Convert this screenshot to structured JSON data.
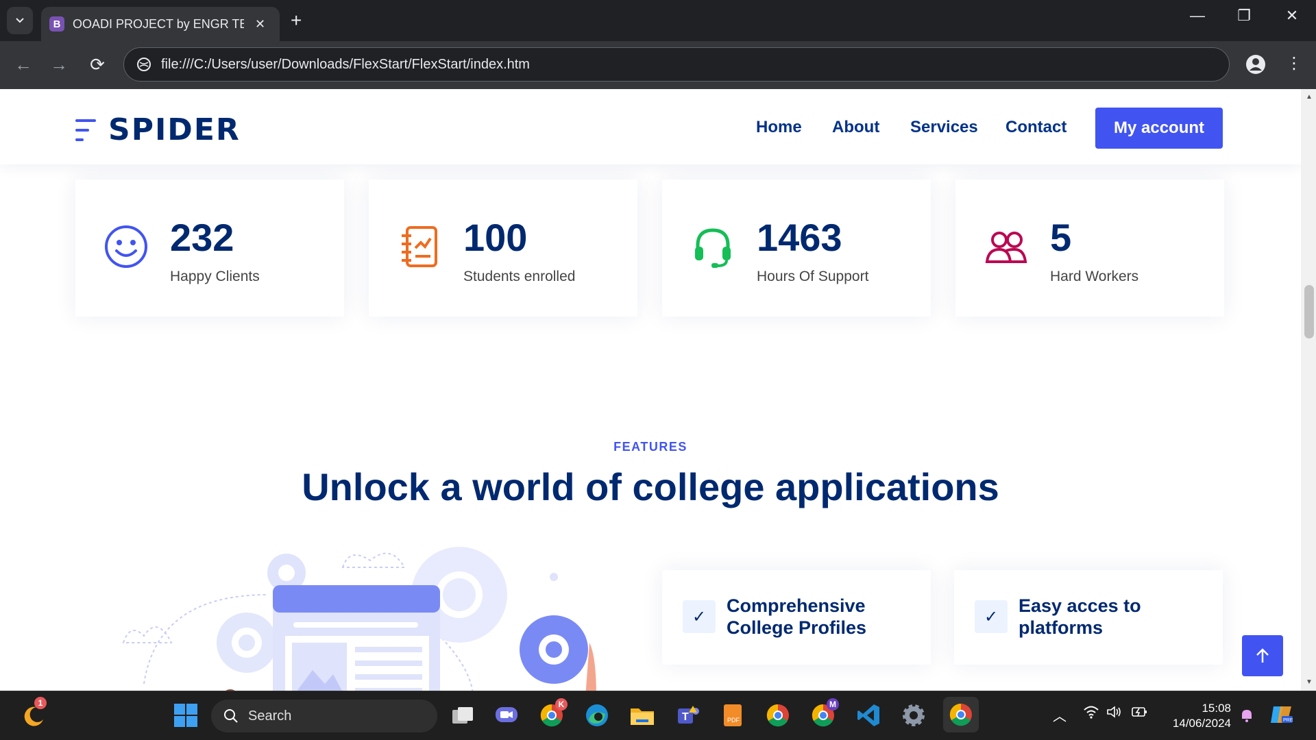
{
  "browser": {
    "tab_title": "OOADI PROJECT by ENGR TEKO",
    "tab_favicon_letter": "B",
    "new_tab_symbol": "+",
    "url": "file:///C:/Users/user/Downloads/FlexStart/FlexStart/index.htm"
  },
  "site": {
    "logo_text": "SPIDER",
    "nav": [
      "Home",
      "About",
      "Services",
      "Contact"
    ],
    "account_button": "My account",
    "counts": [
      {
        "number": "232",
        "label": "Happy Clients",
        "icon": "smiley-icon",
        "color": "#4154f1"
      },
      {
        "number": "100",
        "label": "Students enrolled",
        "icon": "journal-icon",
        "color": "#ee6c20"
      },
      {
        "number": "1463",
        "label": "Hours Of Support",
        "icon": "headset-icon",
        "color": "#15be56"
      },
      {
        "number": "5",
        "label": "Hard Workers",
        "icon": "people-icon",
        "color": "#bb0852"
      }
    ],
    "features_tag": "FEATURES",
    "features_title": "Unlock a world of college applications",
    "features": [
      {
        "title": "Comprehensive College Profiles",
        "icon": "check-icon"
      },
      {
        "title": "Easy acces to platforms",
        "icon": "check-icon"
      }
    ]
  },
  "taskbar": {
    "search_placeholder": "Search",
    "weather_badge": "1",
    "time": "15:08",
    "date": "14/06/2024",
    "chrome_profile_badges": [
      "K",
      "M"
    ]
  },
  "colors": {
    "primary": "#4154f1",
    "heading": "#012970"
  }
}
